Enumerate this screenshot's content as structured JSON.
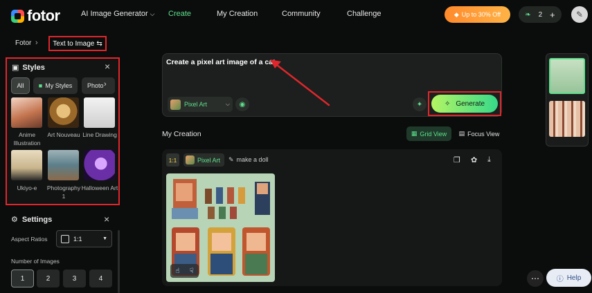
{
  "header": {
    "logo": "fotor",
    "nav": [
      {
        "label": "AI Image Generator",
        "has_dropdown": true
      },
      {
        "label": "Create",
        "active": true
      },
      {
        "label": "My Creation"
      },
      {
        "label": "Community"
      },
      {
        "label": "Challenge"
      }
    ],
    "promo_label": "Up to 30% Off",
    "credits_count": "2",
    "add_symbol": "+"
  },
  "breadcrumb": {
    "root": "Fotor",
    "current": "Text to Image"
  },
  "styles": {
    "title": "Styles",
    "tabs": [
      {
        "label": "All",
        "active": true
      },
      {
        "label": "My Styles"
      },
      {
        "label": "Photo"
      }
    ],
    "items": [
      {
        "label": "Anime Illustration",
        "color": "#c4754f"
      },
      {
        "label": "Art Nouveau",
        "color": "#b98a3a"
      },
      {
        "label": "Line Drawing",
        "color": "#d9d9d9"
      },
      {
        "label": "Ukiyo-e",
        "color": "#d8c8a8"
      },
      {
        "label": "Photography 1",
        "color": "#5c7f8a"
      },
      {
        "label": "Halloween Art",
        "color": "#6a2fa6"
      }
    ]
  },
  "settings": {
    "title": "Settings",
    "aspect_label": "Aspect Ratios",
    "aspect_value": "1:1",
    "count_label": "Number of Images",
    "counts": [
      "1",
      "2",
      "3",
      "4"
    ],
    "selected_count": "1"
  },
  "prompt": {
    "text": "Create a pixel art image of a cat",
    "style_chip": "Pixel Art",
    "generate_label": "Generate"
  },
  "my_creation": {
    "title": "My Creation",
    "grid_view": "Grid View",
    "focus_view": "Focus View",
    "card": {
      "ratio": "1:1",
      "style": "Pixel Art",
      "description": "make a doll"
    }
  },
  "help_label": "Help",
  "colors": {
    "accent": "#5ee08c",
    "highlight_border": "#e0262c"
  }
}
